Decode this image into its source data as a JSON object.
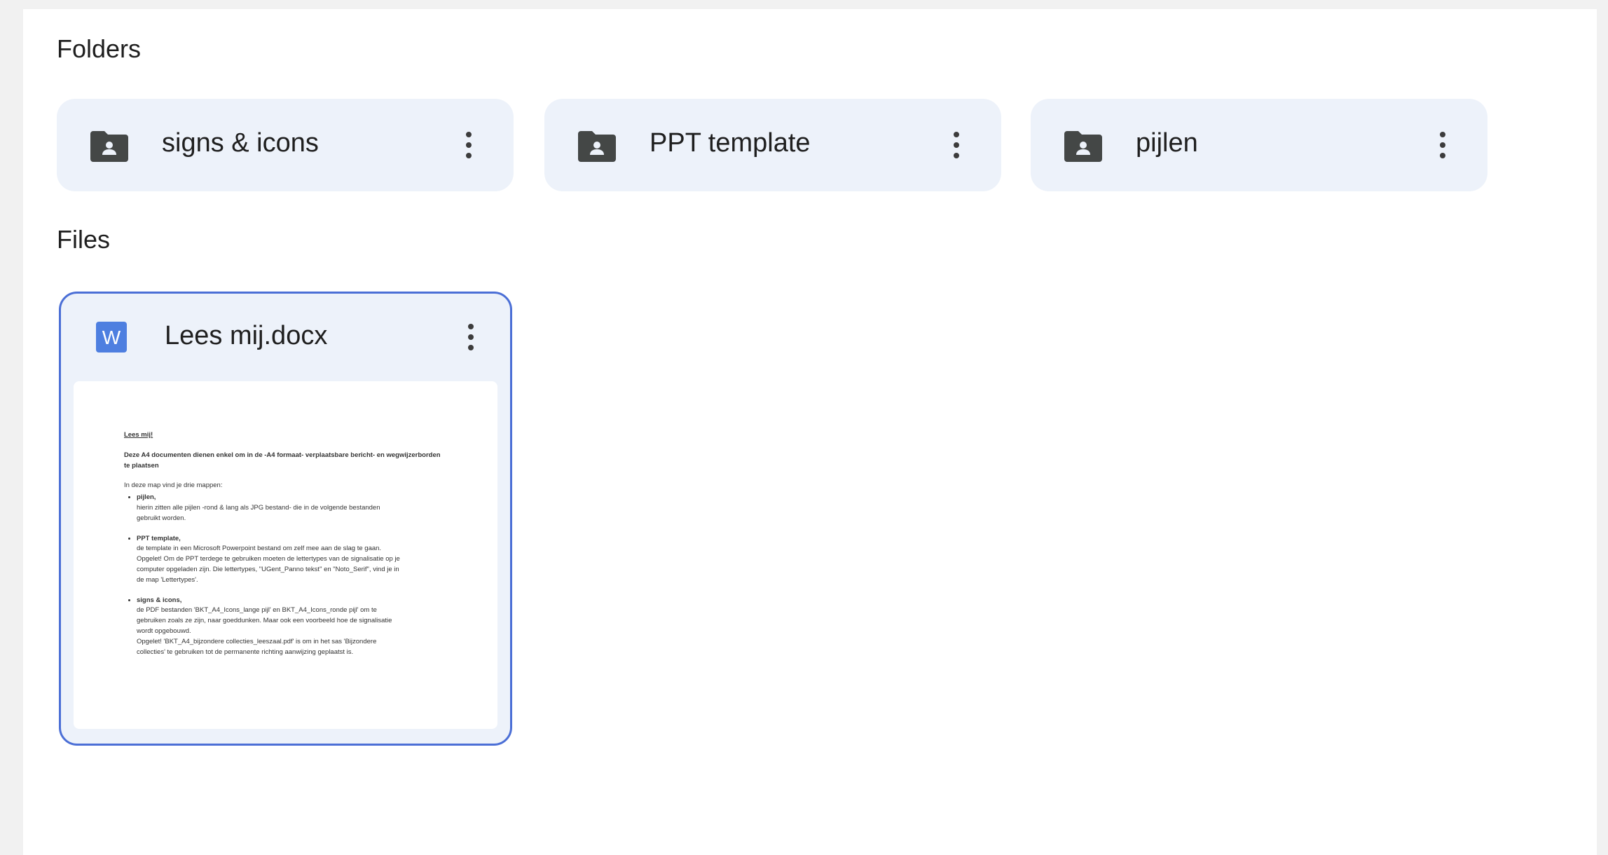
{
  "sections": {
    "folders_heading": "Folders",
    "files_heading": "Files"
  },
  "folders": [
    {
      "name": "signs & icons",
      "icon": "shared-folder-icon"
    },
    {
      "name": "PPT template",
      "icon": "shared-folder-icon"
    },
    {
      "name": "pijlen",
      "icon": "shared-folder-icon"
    }
  ],
  "files": [
    {
      "name": "Lees mij.docx",
      "icon": "word-doc-icon",
      "icon_letter": "W",
      "preview": {
        "title": "Lees mij!",
        "intro": "Deze A4 documenten dienen enkel om in de -A4 formaat- verplaatsbare bericht- en wegwijzerborden te plaatsen",
        "list_lead": "In deze map vind je drie mappen:",
        "items": [
          {
            "heading": "pijlen,",
            "lines": [
              "hierin zitten alle pijlen -rond & lang als JPG bestand- die in de volgende bestanden",
              "gebruikt worden."
            ]
          },
          {
            "heading": "PPT template,",
            "lines": [
              "de template in een Microsoft Powerpoint bestand om zelf mee aan de slag te gaan.",
              "Opgelet! Om de PPT terdege te gebruiken moeten de lettertypes van de signalisatie op je",
              "computer opgeladen zijn. Die lettertypes, \"UGent_Panno tekst\" en \"Noto_Serif\", vind je in",
              "de map 'Lettertypes'."
            ]
          },
          {
            "heading": "signs & icons,",
            "lines": [
              "de PDF bestanden 'BKT_A4_Icons_lange pijl' en BKT_A4_Icons_ronde pijl' om te",
              "gebruiken zoals ze zijn, naar goeddunken. Maar ook een voorbeeld hoe de signalisatie",
              "wordt opgebouwd.",
              "Opgelet! 'BKT_A4_bijzondere collecties_leeszaal.pdf' is om in het sas 'Bijzondere",
              "collecties' te gebruiken tot de permanente richting aanwijzing geplaatst is."
            ]
          }
        ]
      }
    }
  ],
  "colors": {
    "card_bg": "#edf2fa",
    "selection_border": "#4b6fd6",
    "word_blue": "#4e7fe0",
    "icon_gray": "#444746"
  }
}
